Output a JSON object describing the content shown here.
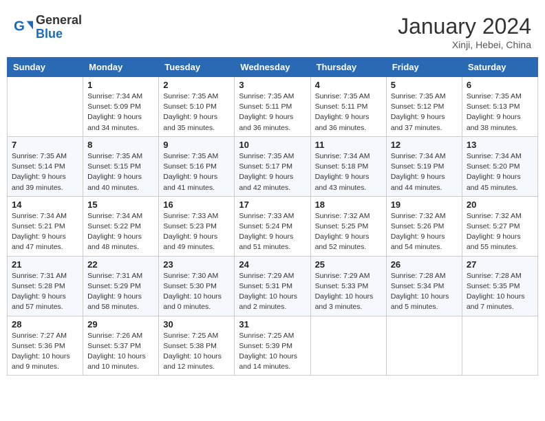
{
  "header": {
    "logo_text_general": "General",
    "logo_text_blue": "Blue",
    "month": "January 2024",
    "location": "Xinji, Hebei, China"
  },
  "weekdays": [
    "Sunday",
    "Monday",
    "Tuesday",
    "Wednesday",
    "Thursday",
    "Friday",
    "Saturday"
  ],
  "weeks": [
    [
      {
        "day": "",
        "sunrise": "",
        "sunset": "",
        "daylight": ""
      },
      {
        "day": "1",
        "sunrise": "Sunrise: 7:34 AM",
        "sunset": "Sunset: 5:09 PM",
        "daylight": "Daylight: 9 hours and 34 minutes."
      },
      {
        "day": "2",
        "sunrise": "Sunrise: 7:35 AM",
        "sunset": "Sunset: 5:10 PM",
        "daylight": "Daylight: 9 hours and 35 minutes."
      },
      {
        "day": "3",
        "sunrise": "Sunrise: 7:35 AM",
        "sunset": "Sunset: 5:11 PM",
        "daylight": "Daylight: 9 hours and 36 minutes."
      },
      {
        "day": "4",
        "sunrise": "Sunrise: 7:35 AM",
        "sunset": "Sunset: 5:11 PM",
        "daylight": "Daylight: 9 hours and 36 minutes."
      },
      {
        "day": "5",
        "sunrise": "Sunrise: 7:35 AM",
        "sunset": "Sunset: 5:12 PM",
        "daylight": "Daylight: 9 hours and 37 minutes."
      },
      {
        "day": "6",
        "sunrise": "Sunrise: 7:35 AM",
        "sunset": "Sunset: 5:13 PM",
        "daylight": "Daylight: 9 hours and 38 minutes."
      }
    ],
    [
      {
        "day": "7",
        "sunrise": "Sunrise: 7:35 AM",
        "sunset": "Sunset: 5:14 PM",
        "daylight": "Daylight: 9 hours and 39 minutes."
      },
      {
        "day": "8",
        "sunrise": "Sunrise: 7:35 AM",
        "sunset": "Sunset: 5:15 PM",
        "daylight": "Daylight: 9 hours and 40 minutes."
      },
      {
        "day": "9",
        "sunrise": "Sunrise: 7:35 AM",
        "sunset": "Sunset: 5:16 PM",
        "daylight": "Daylight: 9 hours and 41 minutes."
      },
      {
        "day": "10",
        "sunrise": "Sunrise: 7:35 AM",
        "sunset": "Sunset: 5:17 PM",
        "daylight": "Daylight: 9 hours and 42 minutes."
      },
      {
        "day": "11",
        "sunrise": "Sunrise: 7:34 AM",
        "sunset": "Sunset: 5:18 PM",
        "daylight": "Daylight: 9 hours and 43 minutes."
      },
      {
        "day": "12",
        "sunrise": "Sunrise: 7:34 AM",
        "sunset": "Sunset: 5:19 PM",
        "daylight": "Daylight: 9 hours and 44 minutes."
      },
      {
        "day": "13",
        "sunrise": "Sunrise: 7:34 AM",
        "sunset": "Sunset: 5:20 PM",
        "daylight": "Daylight: 9 hours and 45 minutes."
      }
    ],
    [
      {
        "day": "14",
        "sunrise": "Sunrise: 7:34 AM",
        "sunset": "Sunset: 5:21 PM",
        "daylight": "Daylight: 9 hours and 47 minutes."
      },
      {
        "day": "15",
        "sunrise": "Sunrise: 7:34 AM",
        "sunset": "Sunset: 5:22 PM",
        "daylight": "Daylight: 9 hours and 48 minutes."
      },
      {
        "day": "16",
        "sunrise": "Sunrise: 7:33 AM",
        "sunset": "Sunset: 5:23 PM",
        "daylight": "Daylight: 9 hours and 49 minutes."
      },
      {
        "day": "17",
        "sunrise": "Sunrise: 7:33 AM",
        "sunset": "Sunset: 5:24 PM",
        "daylight": "Daylight: 9 hours and 51 minutes."
      },
      {
        "day": "18",
        "sunrise": "Sunrise: 7:32 AM",
        "sunset": "Sunset: 5:25 PM",
        "daylight": "Daylight: 9 hours and 52 minutes."
      },
      {
        "day": "19",
        "sunrise": "Sunrise: 7:32 AM",
        "sunset": "Sunset: 5:26 PM",
        "daylight": "Daylight: 9 hours and 54 minutes."
      },
      {
        "day": "20",
        "sunrise": "Sunrise: 7:32 AM",
        "sunset": "Sunset: 5:27 PM",
        "daylight": "Daylight: 9 hours and 55 minutes."
      }
    ],
    [
      {
        "day": "21",
        "sunrise": "Sunrise: 7:31 AM",
        "sunset": "Sunset: 5:28 PM",
        "daylight": "Daylight: 9 hours and 57 minutes."
      },
      {
        "day": "22",
        "sunrise": "Sunrise: 7:31 AM",
        "sunset": "Sunset: 5:29 PM",
        "daylight": "Daylight: 9 hours and 58 minutes."
      },
      {
        "day": "23",
        "sunrise": "Sunrise: 7:30 AM",
        "sunset": "Sunset: 5:30 PM",
        "daylight": "Daylight: 10 hours and 0 minutes."
      },
      {
        "day": "24",
        "sunrise": "Sunrise: 7:29 AM",
        "sunset": "Sunset: 5:31 PM",
        "daylight": "Daylight: 10 hours and 2 minutes."
      },
      {
        "day": "25",
        "sunrise": "Sunrise: 7:29 AM",
        "sunset": "Sunset: 5:33 PM",
        "daylight": "Daylight: 10 hours and 3 minutes."
      },
      {
        "day": "26",
        "sunrise": "Sunrise: 7:28 AM",
        "sunset": "Sunset: 5:34 PM",
        "daylight": "Daylight: 10 hours and 5 minutes."
      },
      {
        "day": "27",
        "sunrise": "Sunrise: 7:28 AM",
        "sunset": "Sunset: 5:35 PM",
        "daylight": "Daylight: 10 hours and 7 minutes."
      }
    ],
    [
      {
        "day": "28",
        "sunrise": "Sunrise: 7:27 AM",
        "sunset": "Sunset: 5:36 PM",
        "daylight": "Daylight: 10 hours and 9 minutes."
      },
      {
        "day": "29",
        "sunrise": "Sunrise: 7:26 AM",
        "sunset": "Sunset: 5:37 PM",
        "daylight": "Daylight: 10 hours and 10 minutes."
      },
      {
        "day": "30",
        "sunrise": "Sunrise: 7:25 AM",
        "sunset": "Sunset: 5:38 PM",
        "daylight": "Daylight: 10 hours and 12 minutes."
      },
      {
        "day": "31",
        "sunrise": "Sunrise: 7:25 AM",
        "sunset": "Sunset: 5:39 PM",
        "daylight": "Daylight: 10 hours and 14 minutes."
      },
      {
        "day": "",
        "sunrise": "",
        "sunset": "",
        "daylight": ""
      },
      {
        "day": "",
        "sunrise": "",
        "sunset": "",
        "daylight": ""
      },
      {
        "day": "",
        "sunrise": "",
        "sunset": "",
        "daylight": ""
      }
    ]
  ]
}
